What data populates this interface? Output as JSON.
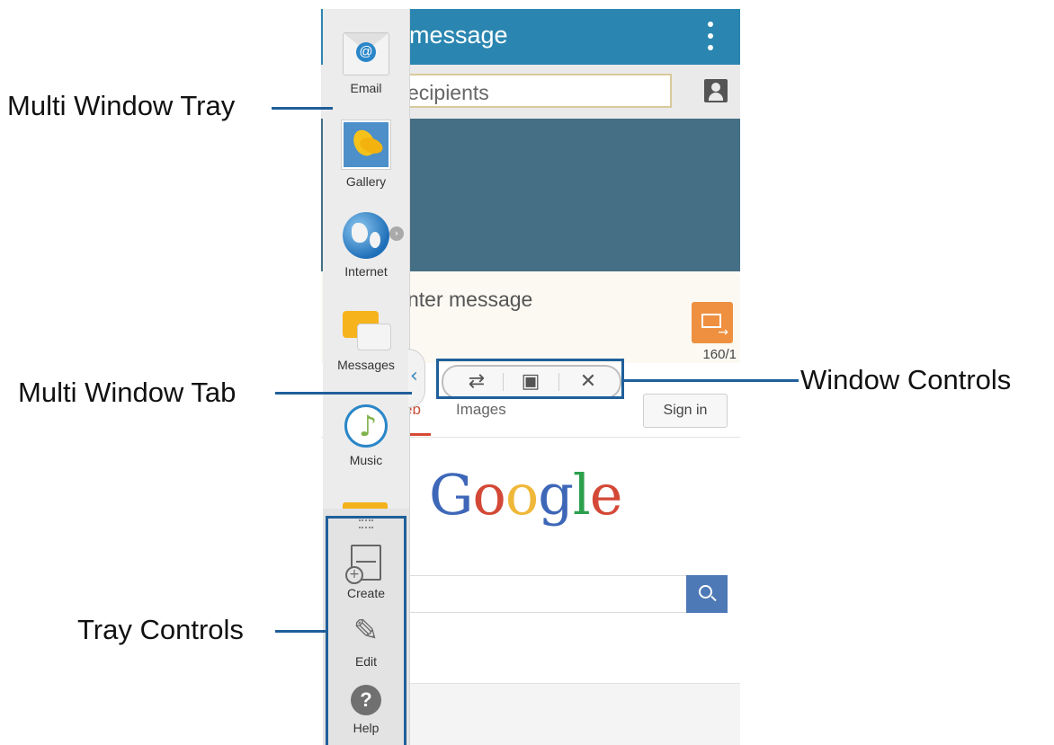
{
  "callouts": {
    "multi_window_tray": "Multi Window Tray",
    "multi_window_tab": "Multi Window Tab",
    "tray_controls": "Tray Controls",
    "window_controls": "Window Controls"
  },
  "message_app": {
    "title": "message",
    "recipients_placeholder": "ecipients",
    "compose_placeholder": "nter message",
    "char_count": "160/1"
  },
  "browser_app": {
    "tab_web": "eb",
    "tab_images": "Images",
    "sign_in": "Sign in",
    "logo_letters": [
      "G",
      "o",
      "o",
      "g",
      "l",
      "e"
    ],
    "logo_colors": [
      "#3e67b8",
      "#d34836",
      "#f0b83a",
      "#3e67b8",
      "#2ca04d",
      "#d34836"
    ]
  },
  "tray": {
    "apps": [
      {
        "label": "Email",
        "icon": "email-icon"
      },
      {
        "label": "Gallery",
        "icon": "gallery-icon"
      },
      {
        "label": "Internet",
        "icon": "internet-icon"
      },
      {
        "label": "Messages",
        "icon": "messages-icon"
      },
      {
        "label": "Music",
        "icon": "music-icon"
      },
      {
        "label": "",
        "icon": "folder-icon"
      }
    ],
    "controls": [
      {
        "label": "Create",
        "icon": "create-icon"
      },
      {
        "label": "Edit",
        "icon": "pencil-icon"
      },
      {
        "label": "Help",
        "icon": "help-icon"
      }
    ]
  },
  "window_controls": {
    "switch_icon": "swap-windows-icon",
    "drag_icon": "drag-content-icon",
    "close_icon": "close-icon"
  },
  "colors": {
    "header_blue": "#2a86b0",
    "callout_blue": "#1f5f9a",
    "send_orange": "#ee9040",
    "search_blue": "#4d79b6"
  }
}
